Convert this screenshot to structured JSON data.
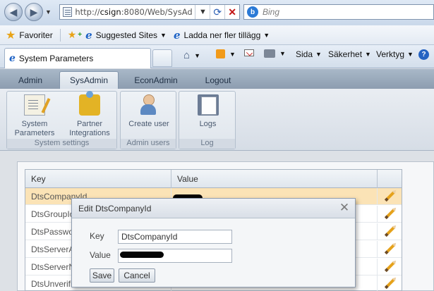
{
  "browser": {
    "url_host": "csign",
    "url_prefix": "http://",
    "url_rest": ":8080/Web/SysAd",
    "search_placeholder": "Bing",
    "search_engine_letter": "b",
    "favorites": {
      "favorites_label": "Favoriter",
      "suggested_sites_label": "Suggested Sites",
      "addons_label": "Ladda ner fler tillägg"
    },
    "tab_title": "System Parameters",
    "commands": {
      "page_label": "Sida",
      "safety_label": "Säkerhet",
      "tools_label": "Verktyg",
      "help_glyph": "?"
    }
  },
  "app": {
    "menu_tabs": [
      {
        "label": "Admin",
        "active": false
      },
      {
        "label": "SysAdmin",
        "active": true
      },
      {
        "label": "EconAdmin",
        "active": false
      },
      {
        "label": "Logout",
        "active": false
      }
    ],
    "ribbon": {
      "groups": [
        {
          "label": "System settings",
          "buttons": [
            {
              "line1": "System",
              "line2": "Parameters",
              "icon": "document-pencil-icon"
            },
            {
              "line1": "Partner",
              "line2": "Integrations",
              "icon": "puzzle-icon"
            }
          ]
        },
        {
          "label": "Admin users",
          "buttons": [
            {
              "line1": "Create user",
              "line2": "",
              "icon": "user-add-icon"
            }
          ]
        },
        {
          "label": "Log",
          "buttons": [
            {
              "line1": "Logs",
              "line2": "",
              "icon": "logbook-icon"
            }
          ]
        }
      ]
    },
    "grid": {
      "columns": [
        "Key",
        "Value"
      ],
      "rows": [
        {
          "key": "DtsCompanyId",
          "selected": true,
          "value_redacted": true
        },
        {
          "key": "DtsGroupIo",
          "selected": false,
          "value_redacted": false
        },
        {
          "key": "DtsPasswo",
          "selected": false,
          "value_redacted": false
        },
        {
          "key": "DtsServerA",
          "selected": false,
          "value_redacted": false
        },
        {
          "key": "DtsServerN",
          "selected": false,
          "value_redacted": false
        },
        {
          "key": "DtsUnverifi",
          "selected": false,
          "value_redacted": false
        }
      ]
    },
    "dialog": {
      "title": "Edit DtsCompanyId",
      "key_label": "Key",
      "key_value": "DtsCompanyId",
      "value_label": "Value",
      "value_redacted": true,
      "save_label": "Save",
      "cancel_label": "Cancel"
    }
  },
  "colors": {
    "selected_row": "#fbe3b6",
    "app_header": "#8d9db0",
    "accent_blue": "#1e63c6"
  }
}
